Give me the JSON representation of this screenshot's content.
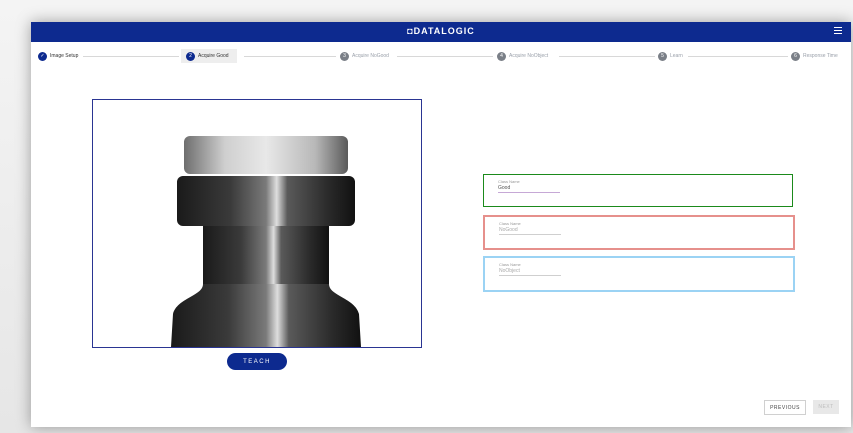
{
  "header": {
    "logo": "◘DATALOGIC"
  },
  "stepper": {
    "steps": [
      {
        "num": "✓",
        "label": "Image Setup"
      },
      {
        "num": "2",
        "label": "Acquire Good"
      },
      {
        "num": "3",
        "label": "Acquire NoGood"
      },
      {
        "num": "4",
        "label": "Acquire NoObject"
      },
      {
        "num": "5",
        "label": "Learn"
      },
      {
        "num": "6",
        "label": "Response Time"
      }
    ]
  },
  "teach_label": "TEACH",
  "fields": [
    {
      "label": "Class Name",
      "value": "Good"
    },
    {
      "label": "Class Name",
      "value": "NoGood"
    },
    {
      "label": "Class Name",
      "value": "NoObject"
    }
  ],
  "footer": {
    "previous": "PREVIOUS",
    "next": "NEXT"
  },
  "colors": {
    "primary": "#0d2a8f",
    "good_border": "#1b8a1b",
    "nogood_border": "#e6908c",
    "noobject_border": "#9bd3f4"
  }
}
